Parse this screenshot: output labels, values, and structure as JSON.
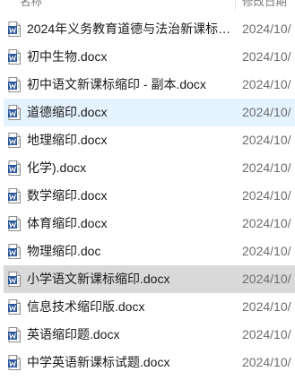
{
  "header": {
    "name_label": "名称",
    "date_label": "修改日期"
  },
  "files": [
    {
      "name": "2024年义务教育道德与法治新课标…",
      "date": "2024/10/",
      "state": "normal"
    },
    {
      "name": "初中生物.docx",
      "date": "2024/10/",
      "state": "normal"
    },
    {
      "name": "初中语文新课标缩印 - 副本.docx",
      "date": "2024/10/",
      "state": "normal"
    },
    {
      "name": "道德缩印.docx",
      "date": "2024/10/",
      "state": "hover"
    },
    {
      "name": "地理缩印.docx",
      "date": "2024/10/",
      "state": "normal"
    },
    {
      "name": "化学).docx",
      "date": "2024/10/",
      "state": "normal"
    },
    {
      "name": "数学缩印.docx",
      "date": "2024/10/",
      "state": "normal"
    },
    {
      "name": "体育缩印.docx",
      "date": "2024/10/",
      "state": "normal"
    },
    {
      "name": "物理缩印.doc",
      "date": "2024/10/",
      "state": "normal"
    },
    {
      "name": "小学语文新课标缩印.docx",
      "date": "2024/10/",
      "state": "selected"
    },
    {
      "name": "信息技术缩印版.docx",
      "date": "2024/10/",
      "state": "normal"
    },
    {
      "name": "英语缩印题.docx",
      "date": "2024/10/",
      "state": "normal"
    },
    {
      "name": "中学英语新课标试题.docx",
      "date": "2024/10/",
      "state": "normal"
    }
  ],
  "icon": "word-document-icon",
  "colors": {
    "word_blue": "#2b579a",
    "hover_bg": "#e5f3ff",
    "selected_bg": "#d9d9d9"
  }
}
